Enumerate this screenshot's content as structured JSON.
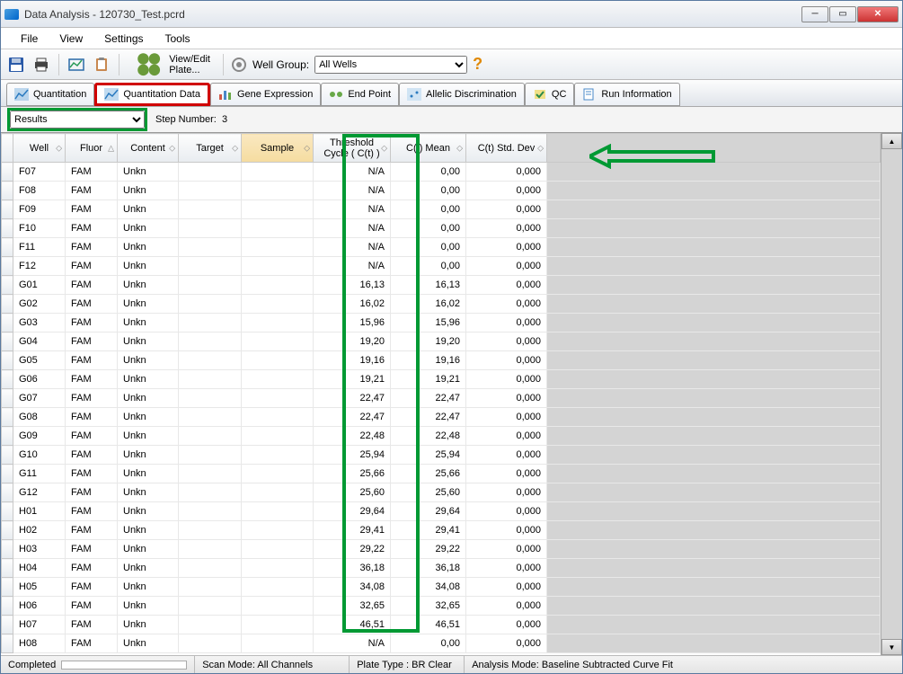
{
  "window_title": "Data Analysis - 120730_Test.pcrd",
  "menu": {
    "file": "File",
    "view": "View",
    "settings": "Settings",
    "tools": "Tools"
  },
  "toolbar": {
    "view_edit_plate": "View/Edit Plate...",
    "well_group_label": "Well Group:",
    "well_group_value": "All Wells",
    "help": "?"
  },
  "tabs": {
    "quantitation": "Quantitation",
    "quantitation_data": "Quantitation Data",
    "gene_expression": "Gene Expression",
    "end_point": "End Point",
    "allelic": "Allelic Discrimination",
    "qc": "QC",
    "run_info": "Run Information"
  },
  "controls": {
    "results_dd": "Results",
    "step_label": "Step Number:",
    "step_value": "3"
  },
  "columns": {
    "well": "Well",
    "fluor": "Fluor",
    "content": "Content",
    "target": "Target",
    "sample": "Sample",
    "threshold": "Threshold Cycle ( C(t) )",
    "mean": "C(t) Mean",
    "stddev": "C(t) Std. Dev"
  },
  "rows": [
    {
      "well": "F07",
      "fluor": "FAM",
      "content": "Unkn",
      "thresh": "N/A",
      "mean": "0,00",
      "std": "0,000"
    },
    {
      "well": "F08",
      "fluor": "FAM",
      "content": "Unkn",
      "thresh": "N/A",
      "mean": "0,00",
      "std": "0,000"
    },
    {
      "well": "F09",
      "fluor": "FAM",
      "content": "Unkn",
      "thresh": "N/A",
      "mean": "0,00",
      "std": "0,000"
    },
    {
      "well": "F10",
      "fluor": "FAM",
      "content": "Unkn",
      "thresh": "N/A",
      "mean": "0,00",
      "std": "0,000"
    },
    {
      "well": "F11",
      "fluor": "FAM",
      "content": "Unkn",
      "thresh": "N/A",
      "mean": "0,00",
      "std": "0,000"
    },
    {
      "well": "F12",
      "fluor": "FAM",
      "content": "Unkn",
      "thresh": "N/A",
      "mean": "0,00",
      "std": "0,000"
    },
    {
      "well": "G01",
      "fluor": "FAM",
      "content": "Unkn",
      "thresh": "16,13",
      "mean": "16,13",
      "std": "0,000"
    },
    {
      "well": "G02",
      "fluor": "FAM",
      "content": "Unkn",
      "thresh": "16,02",
      "mean": "16,02",
      "std": "0,000"
    },
    {
      "well": "G03",
      "fluor": "FAM",
      "content": "Unkn",
      "thresh": "15,96",
      "mean": "15,96",
      "std": "0,000"
    },
    {
      "well": "G04",
      "fluor": "FAM",
      "content": "Unkn",
      "thresh": "19,20",
      "mean": "19,20",
      "std": "0,000"
    },
    {
      "well": "G05",
      "fluor": "FAM",
      "content": "Unkn",
      "thresh": "19,16",
      "mean": "19,16",
      "std": "0,000"
    },
    {
      "well": "G06",
      "fluor": "FAM",
      "content": "Unkn",
      "thresh": "19,21",
      "mean": "19,21",
      "std": "0,000"
    },
    {
      "well": "G07",
      "fluor": "FAM",
      "content": "Unkn",
      "thresh": "22,47",
      "mean": "22,47",
      "std": "0,000"
    },
    {
      "well": "G08",
      "fluor": "FAM",
      "content": "Unkn",
      "thresh": "22,47",
      "mean": "22,47",
      "std": "0,000"
    },
    {
      "well": "G09",
      "fluor": "FAM",
      "content": "Unkn",
      "thresh": "22,48",
      "mean": "22,48",
      "std": "0,000"
    },
    {
      "well": "G10",
      "fluor": "FAM",
      "content": "Unkn",
      "thresh": "25,94",
      "mean": "25,94",
      "std": "0,000"
    },
    {
      "well": "G11",
      "fluor": "FAM",
      "content": "Unkn",
      "thresh": "25,66",
      "mean": "25,66",
      "std": "0,000"
    },
    {
      "well": "G12",
      "fluor": "FAM",
      "content": "Unkn",
      "thresh": "25,60",
      "mean": "25,60",
      "std": "0,000"
    },
    {
      "well": "H01",
      "fluor": "FAM",
      "content": "Unkn",
      "thresh": "29,64",
      "mean": "29,64",
      "std": "0,000"
    },
    {
      "well": "H02",
      "fluor": "FAM",
      "content": "Unkn",
      "thresh": "29,41",
      "mean": "29,41",
      "std": "0,000"
    },
    {
      "well": "H03",
      "fluor": "FAM",
      "content": "Unkn",
      "thresh": "29,22",
      "mean": "29,22",
      "std": "0,000"
    },
    {
      "well": "H04",
      "fluor": "FAM",
      "content": "Unkn",
      "thresh": "36,18",
      "mean": "36,18",
      "std": "0,000"
    },
    {
      "well": "H05",
      "fluor": "FAM",
      "content": "Unkn",
      "thresh": "34,08",
      "mean": "34,08",
      "std": "0,000"
    },
    {
      "well": "H06",
      "fluor": "FAM",
      "content": "Unkn",
      "thresh": "32,65",
      "mean": "32,65",
      "std": "0,000"
    },
    {
      "well": "H07",
      "fluor": "FAM",
      "content": "Unkn",
      "thresh": "46,51",
      "mean": "46,51",
      "std": "0,000"
    },
    {
      "well": "H08",
      "fluor": "FAM",
      "content": "Unkn",
      "thresh": "N/A",
      "mean": "0,00",
      "std": "0,000"
    }
  ],
  "status": {
    "completed": "Completed",
    "scan_mode": "Scan Mode: All Channels",
    "plate_type": "Plate Type : BR Clear",
    "analysis_mode": "Analysis Mode: Baseline Subtracted Curve Fit"
  }
}
